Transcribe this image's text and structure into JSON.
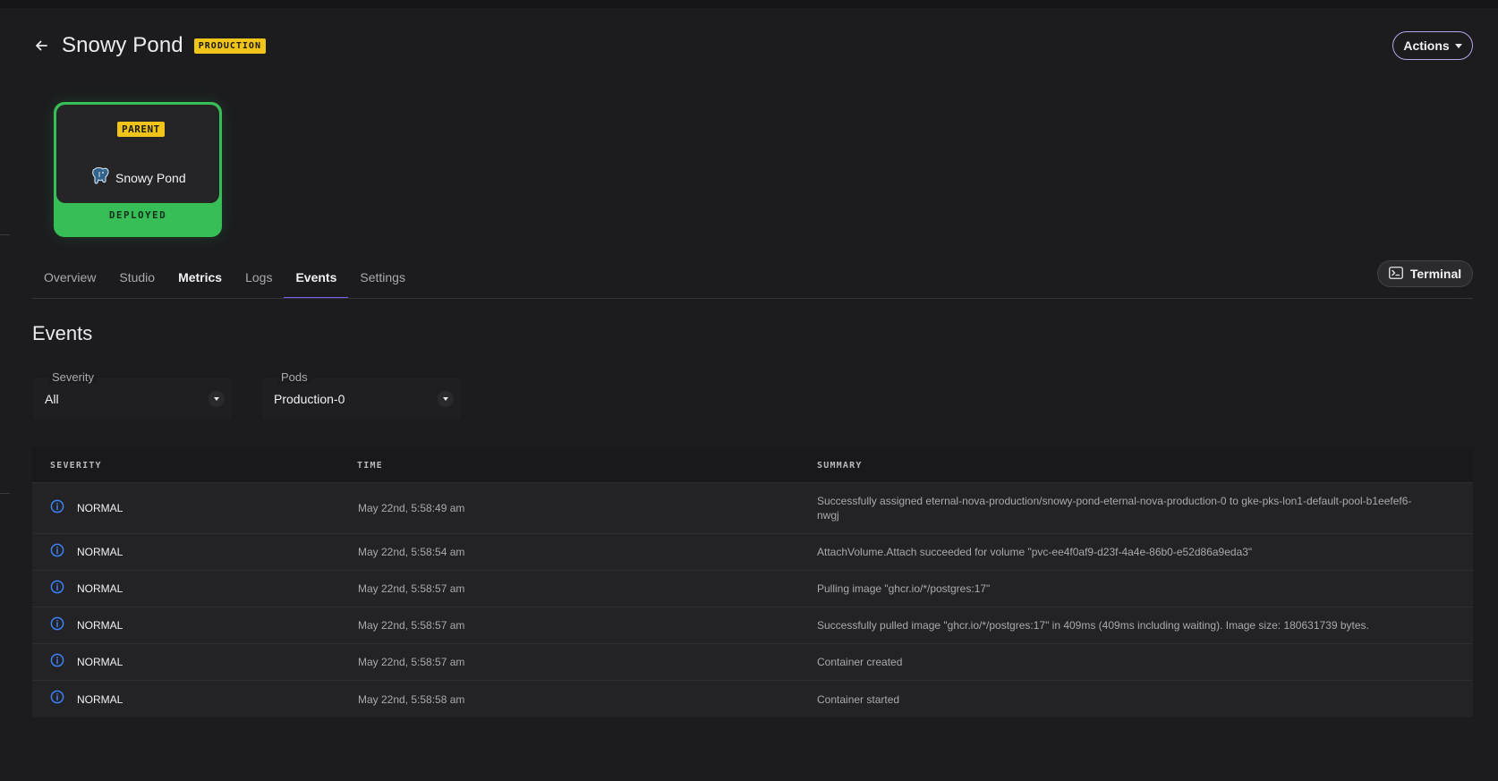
{
  "header": {
    "title": "Snowy Pond",
    "environment_badge": "PRODUCTION",
    "actions_label": "Actions"
  },
  "service_card": {
    "role_badge": "PARENT",
    "service_name": "Snowy Pond",
    "icon": "postgres-elephant-icon",
    "status": "DEPLOYED",
    "status_color": "#38be56"
  },
  "tabs": [
    {
      "label": "Overview",
      "active": false
    },
    {
      "label": "Studio",
      "active": false
    },
    {
      "label": "Metrics",
      "active": false
    },
    {
      "label": "Logs",
      "active": false
    },
    {
      "label": "Events",
      "active": true
    },
    {
      "label": "Settings",
      "active": false
    }
  ],
  "terminal_label": "Terminal",
  "section": {
    "title": "Events"
  },
  "filters": {
    "severity": {
      "label": "Severity",
      "value": "All"
    },
    "pods": {
      "label": "Pods",
      "value": "Production-0"
    }
  },
  "table": {
    "columns": [
      "SEVERITY",
      "TIME",
      "SUMMARY"
    ],
    "rows": [
      {
        "severity": "NORMAL",
        "time": "May 22nd, 5:58:49 am",
        "summary": "Successfully assigned eternal-nova-production/snowy-pond-eternal-nova-production-0 to gke-pks-lon1-default-pool-b1eefef6-nwgj"
      },
      {
        "severity": "NORMAL",
        "time": "May 22nd, 5:58:54 am",
        "summary": "AttachVolume.Attach succeeded for volume \"pvc-ee4f0af9-d23f-4a4e-86b0-e52d86a9eda3\""
      },
      {
        "severity": "NORMAL",
        "time": "May 22nd, 5:58:57 am",
        "summary": "Pulling image \"ghcr.io/*/postgres:17\""
      },
      {
        "severity": "NORMAL",
        "time": "May 22nd, 5:58:57 am",
        "summary": "Successfully pulled image \"ghcr.io/*/postgres:17\" in 409ms (409ms including waiting). Image size: 180631739 bytes."
      },
      {
        "severity": "NORMAL",
        "time": "May 22nd, 5:58:57 am",
        "summary": "Container created"
      },
      {
        "severity": "NORMAL",
        "time": "May 22nd, 5:58:58 am",
        "summary": "Container started"
      }
    ]
  },
  "colors": {
    "accent": "#7b5cf0",
    "badge_yellow": "#f0c419",
    "info_blue": "#3b82f6",
    "background": "#1c1c1f"
  }
}
